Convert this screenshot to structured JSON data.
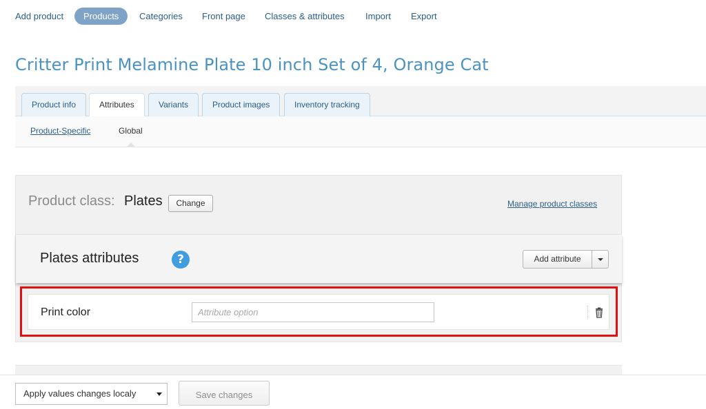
{
  "topnav": {
    "items": [
      {
        "label": "Add product"
      },
      {
        "label": "Products",
        "active": true
      },
      {
        "label": "Categories"
      },
      {
        "label": "Front page"
      },
      {
        "label": "Classes & attributes"
      },
      {
        "label": "Import"
      },
      {
        "label": "Export"
      }
    ]
  },
  "page": {
    "title": "Critter Print Melamine Plate 10 inch Set of 4, Orange Cat"
  },
  "tabs": [
    {
      "label": "Product info"
    },
    {
      "label": "Attributes",
      "active": true
    },
    {
      "label": "Variants"
    },
    {
      "label": "Product images"
    },
    {
      "label": "Inventory tracking"
    }
  ],
  "subtabs": [
    {
      "label": "Product-Specific"
    },
    {
      "label": "Global",
      "active": true
    }
  ],
  "product_class": {
    "label": "Product class:",
    "value": "Plates",
    "change_label": "Change",
    "manage_link": "Manage product classes"
  },
  "attribute_group": {
    "title": "Plates attributes",
    "help_icon": "question-circle-icon",
    "add_attribute_label": "Add attribute",
    "attributes": [
      {
        "name": "Print color",
        "option_value": "",
        "option_placeholder": "Attribute option"
      }
    ]
  },
  "bottom_bar": {
    "apply_select_value": "Apply values changes localy",
    "save_label": "Save changes"
  },
  "colors": {
    "accent_blue": "#4b93c3",
    "active_nav": "#7fa3c6",
    "link": "#2a5d8a",
    "highlight_red": "#e01010",
    "help_blue": "#3f9de0"
  }
}
